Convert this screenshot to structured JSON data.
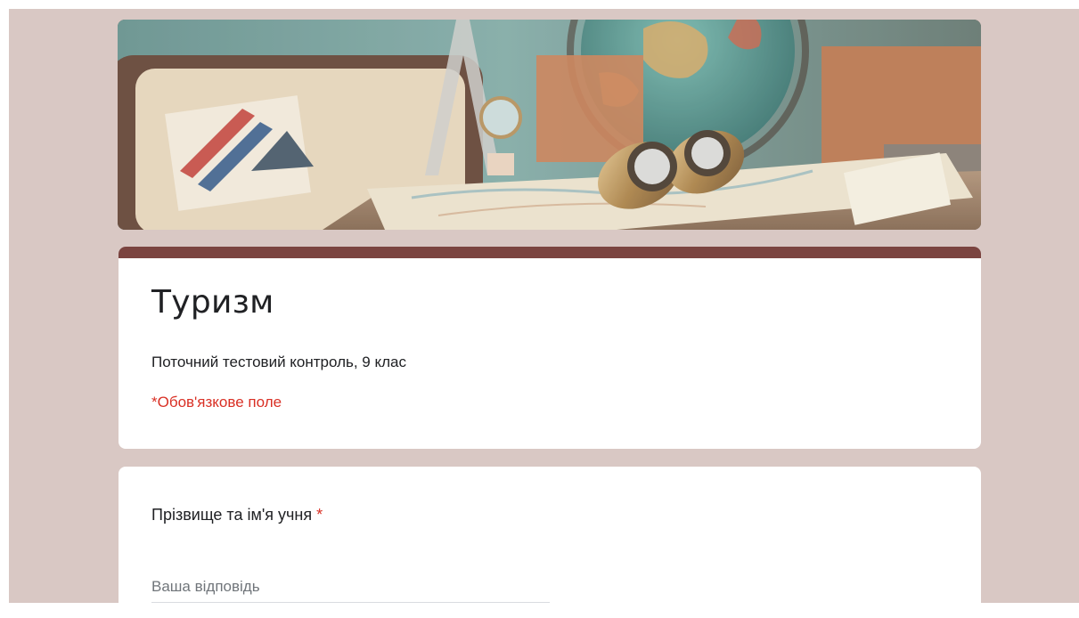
{
  "header_image": {
    "description_icon": "travel-header-image"
  },
  "form": {
    "title": "Туризм",
    "description": "Поточний тестовий контроль, 9 клас",
    "required_note": "*Обов'язкове поле"
  },
  "questions": [
    {
      "title": "Прізвище та ім'я учня",
      "required_mark": "*",
      "answer_placeholder": "Ваша відповідь",
      "answer_value": ""
    }
  ],
  "colors": {
    "page_background": "#d9c8c4",
    "accent": "#7b4440",
    "required": "#d93025"
  }
}
